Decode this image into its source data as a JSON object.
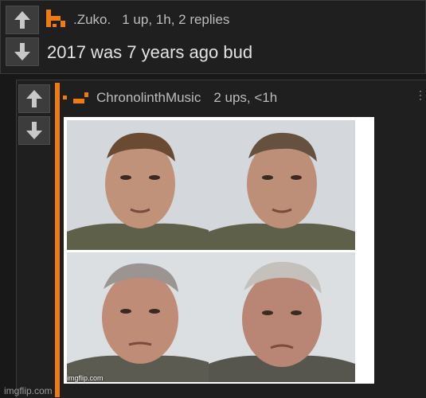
{
  "colors": {
    "accent": "#f07b10",
    "background": "#181818",
    "card": "#1f1f1f",
    "text": "#e2e2e2"
  },
  "comment1": {
    "username": ".Zuko.",
    "meta": "1 up, 1h, 2 replies",
    "text": "2017 was 7 years ago bud",
    "upvote_icon": "arrow-up-icon",
    "downvote_icon": "arrow-down-icon"
  },
  "comment2": {
    "username": "ChronolinthMusic",
    "meta": "2 ups, <1h",
    "menu": "⋮",
    "image": {
      "description": "four-panel aging meme",
      "watermark": "imgflip.com"
    }
  },
  "footer": {
    "text": "imgflip.com"
  }
}
